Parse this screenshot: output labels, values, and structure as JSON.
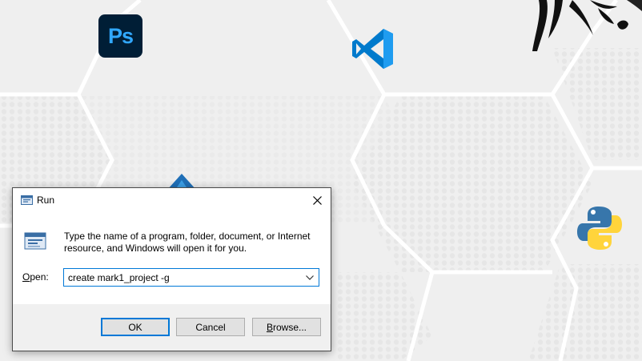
{
  "desktop": {
    "icons": [
      {
        "name": "Adobe Photoshop",
        "icon": "photoshop-icon",
        "text": "Ps"
      },
      {
        "name": "Visual Studio Code",
        "icon": "vscode-icon"
      },
      {
        "name": "Python",
        "icon": "python-icon"
      }
    ]
  },
  "run_dialog": {
    "title": "Run",
    "description": "Type the name of a program, folder, document, or Internet resource, and Windows will open it for you.",
    "open_label_accel": "O",
    "open_label_rest": "pen:",
    "open_value": "create mark1_project -g",
    "buttons": {
      "ok": "OK",
      "cancel": "Cancel",
      "browse_accel": "B",
      "browse_rest": "rowse..."
    }
  },
  "colors": {
    "accent": "#0078d7",
    "ps_bg": "#001e36",
    "ps_text": "#31a8ff",
    "vscode": "#007acc",
    "python_blue": "#3776ab",
    "python_yellow": "#ffd43b"
  }
}
